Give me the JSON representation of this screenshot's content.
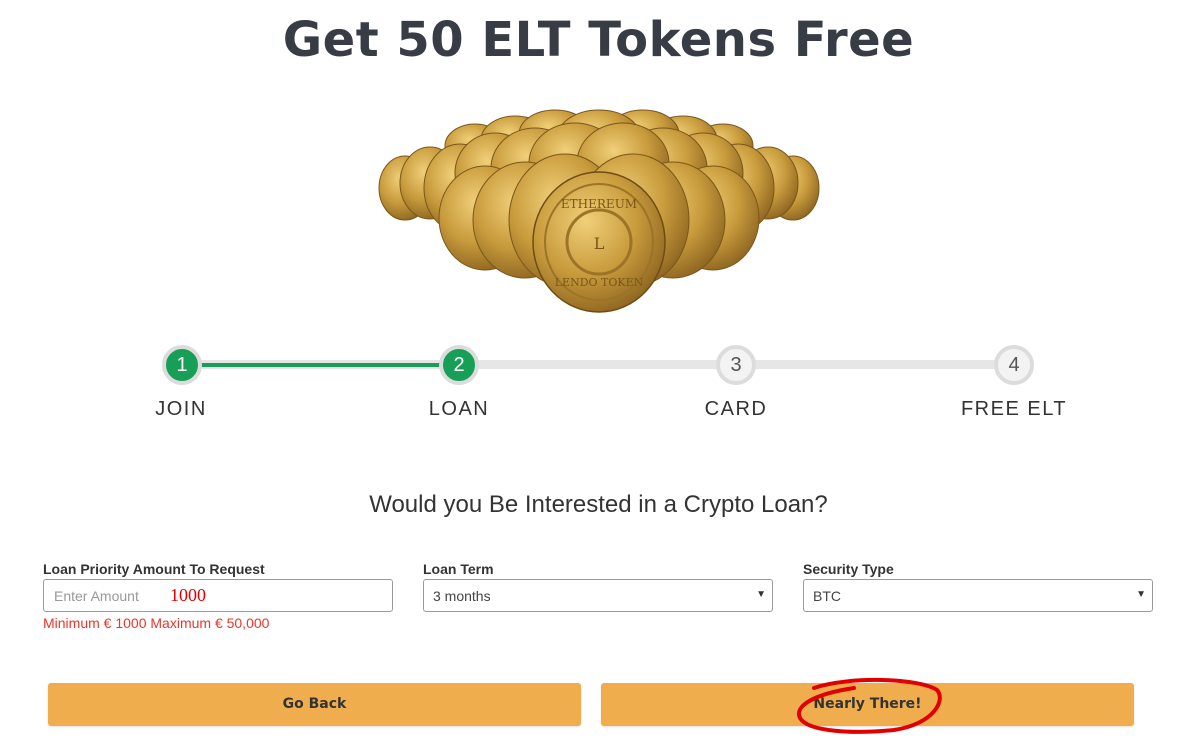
{
  "title": "Get 50 ELT Tokens Free",
  "hero": {
    "image": "ethereum-lendo-token-coins",
    "coin_text_top": "ETHEREUM",
    "coin_text_bottom": "LENDO TOKEN",
    "coin_letter": "L"
  },
  "steps": [
    {
      "number": "1",
      "label": "JOIN",
      "state": "done"
    },
    {
      "number": "2",
      "label": "LOAN",
      "state": "done"
    },
    {
      "number": "3",
      "label": "CARD",
      "state": "todo"
    },
    {
      "number": "4",
      "label": "FREE ELT",
      "state": "todo"
    }
  ],
  "progress_fraction": 0.333,
  "question": "Would you Be Interested in a Crypto Loan?",
  "form": {
    "amount": {
      "label": "Loan Priority Amount To Request",
      "placeholder": "Enter Amount",
      "handwritten_value": "1000",
      "hint": "Minimum € 1000 Maximum € 50,000"
    },
    "term": {
      "label": "Loan Term",
      "selected": "3 months"
    },
    "security": {
      "label": "Security Type",
      "selected": "BTC"
    }
  },
  "buttons": {
    "back": "Go Back",
    "next": "Nearly There!"
  },
  "colors": {
    "primary_green": "#179f57",
    "button_orange": "#f0ad4e",
    "error_red": "#e8372a",
    "annotation_red": "#e00000"
  }
}
